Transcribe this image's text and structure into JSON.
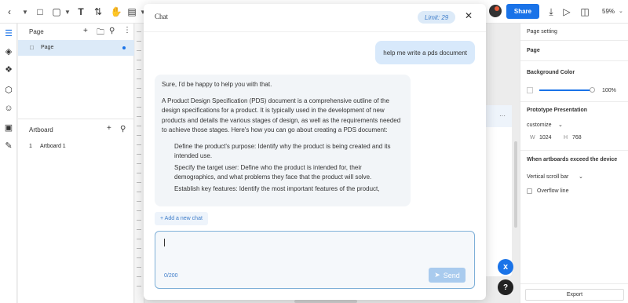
{
  "toolbar": {
    "share_label": "Share",
    "zoom_label": "59%"
  },
  "pages_panel": {
    "title": "Page",
    "items": [
      {
        "label": "Page"
      }
    ],
    "artboard_title": "Artboard",
    "artboards": [
      {
        "index": "1",
        "label": "Artboard 1"
      }
    ]
  },
  "chat": {
    "title": "Chat",
    "limit_label": "Limit: 29",
    "user_message": "help me write a pds document",
    "ai_response": {
      "p1": "Sure, I'd be happy to help you with that.",
      "p2": "A Product Design Specification (PDS) document is a comprehensive outline of the design specifications for a product. It is typically used in the development of new products and details the various stages of design, as well as the requirements needed to achieve those stages. Here's how you can go about creating a PDS document:",
      "items": [
        "Define the product's purpose: Identify why the product is being created and its intended use.",
        "Specify the target user: Define who the product is intended for, their demographics, and what problems they face that the product will solve.",
        "Establish key features: Identify the most important features of the product,"
      ]
    },
    "add_chat_label": "+ Add a new chat",
    "char_count": "0/200",
    "send_label": "Send"
  },
  "right_panel": {
    "title": "Page setting",
    "section_page": "Page",
    "bg_color_label": "Background Color",
    "bg_opacity": "100%",
    "proto_title": "Prototype Presentation",
    "customize_label": "customize",
    "width_label": "W",
    "width_value": "1024",
    "height_label": "H",
    "height_value": "768",
    "overflow_title": "When artboards exceed the device",
    "scroll_label": "Vertical scroll bar",
    "overflow_line_label": "Overflow line",
    "export_label": "Export"
  },
  "colors": {
    "accent": "#1a73e8",
    "chat_bubble_user": "#d8e9fb",
    "page_selected": "#dceaf8"
  },
  "floating": {
    "close_icon": "x",
    "help_label": "?"
  }
}
